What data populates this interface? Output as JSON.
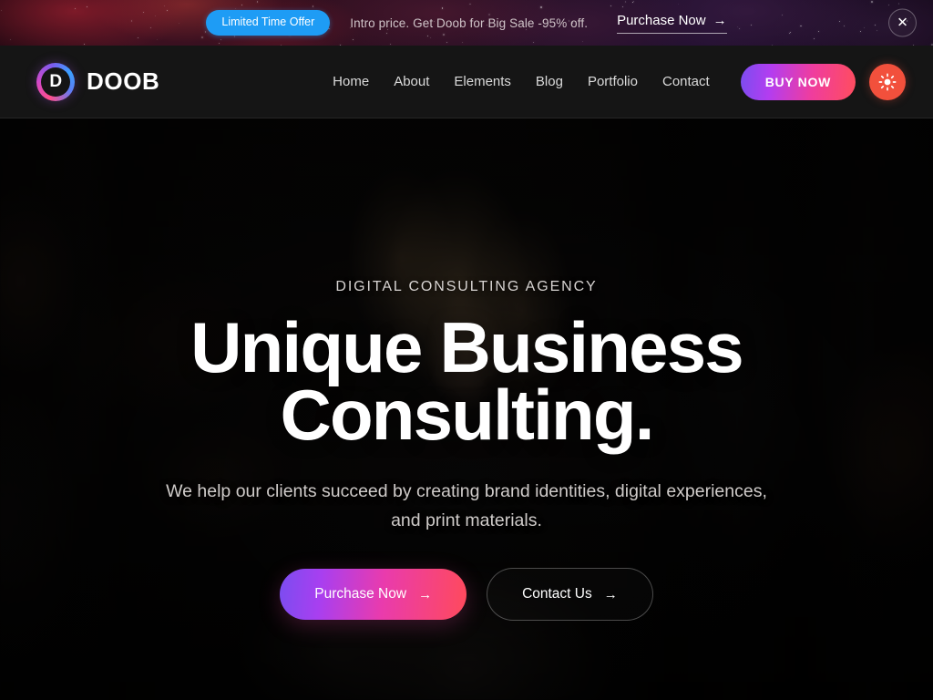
{
  "promo": {
    "badge_label": "Limited Time Offer",
    "message": "Intro price. Get Doob for Big Sale -95% off.",
    "cta_label": "Purchase Now",
    "cta_arrow": "→",
    "close_icon": "✕",
    "badge_color": "#1e9cf5"
  },
  "header": {
    "brand": {
      "mark_letter": "D",
      "name": "DOOB"
    },
    "nav": [
      {
        "label": "Home"
      },
      {
        "label": "About"
      },
      {
        "label": "Elements"
      },
      {
        "label": "Blog"
      },
      {
        "label": "Portfolio"
      },
      {
        "label": "Contact"
      }
    ],
    "buy_label": "BUY NOW",
    "theme_toggle_icon": "sun-icon",
    "theme_toggle_color": "#f2503c",
    "buy_gradient_from": "#7b4df0",
    "buy_gradient_to": "#ff4d5e"
  },
  "hero": {
    "eyebrow": "DIGITAL CONSULTING AGENCY",
    "title_line1": "Unique Business",
    "title_line2": "Consulting.",
    "subtitle_line1": "We help our clients succeed by creating brand identities, digital",
    "subtitle_line2": "experiences, and print materials.",
    "primary_button": {
      "label": "Purchase Now",
      "arrow": "→"
    },
    "secondary_button": {
      "label": "Contact Us",
      "arrow": "→"
    }
  }
}
